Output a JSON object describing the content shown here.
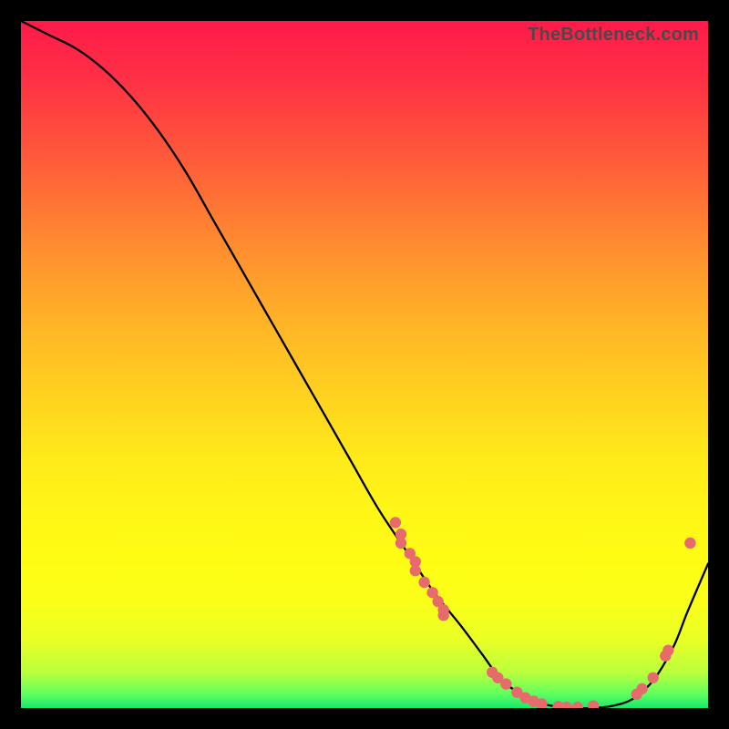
{
  "watermark": "TheBottleneck.com",
  "chart_data": {
    "type": "line",
    "title": "",
    "xlabel": "",
    "ylabel": "",
    "xlim": [
      0,
      100
    ],
    "ylim": [
      0,
      100
    ],
    "grid": false,
    "legend": false,
    "series": [
      {
        "name": "bottleneck-curve",
        "color": "#000000",
        "x": [
          0,
          4,
          8,
          12,
          16,
          20,
          24,
          28,
          32,
          36,
          40,
          44,
          48,
          52,
          56,
          60,
          64,
          67,
          70,
          73,
          76,
          80,
          83,
          86,
          89,
          92,
          95,
          97,
          100
        ],
        "y": [
          100,
          98,
          96,
          93,
          89,
          84,
          78,
          71,
          64,
          57,
          50,
          43,
          36,
          29,
          23,
          17,
          12,
          8,
          4,
          2,
          0.6,
          0,
          0,
          0.3,
          1.3,
          4,
          9,
          14,
          21
        ]
      }
    ],
    "points": [
      {
        "name": "cluster-left-descent",
        "color": "#e76b6d",
        "x": [
          54.5,
          55.3,
          55.3,
          56.6,
          57.4,
          57.4,
          58.7,
          59.9,
          60.7,
          61.5,
          61.5
        ],
        "y": [
          27.0,
          25.3,
          24.0,
          22.5,
          21.3,
          20.0,
          18.3,
          16.8,
          15.5,
          14.3,
          13.5
        ]
      },
      {
        "name": "cluster-valley",
        "color": "#e76b6d",
        "x": [
          68.6,
          69.4,
          70.6,
          72.2,
          73.4,
          74.6,
          75.8,
          78.2,
          79.4,
          81.0,
          83.3
        ],
        "y": [
          5.2,
          4.4,
          3.5,
          2.3,
          1.5,
          1.0,
          0.6,
          0.2,
          0.1,
          0.1,
          0.3
        ]
      },
      {
        "name": "cluster-right-ascent",
        "color": "#e76b6d",
        "x": [
          89.6,
          90.4,
          92.0,
          93.8,
          94.2
        ],
        "y": [
          2.0,
          2.8,
          4.4,
          7.6,
          8.4
        ]
      },
      {
        "name": "outlier-high-right",
        "color": "#e76b6d",
        "x": [
          97.4
        ],
        "y": [
          24.0
        ]
      }
    ]
  }
}
